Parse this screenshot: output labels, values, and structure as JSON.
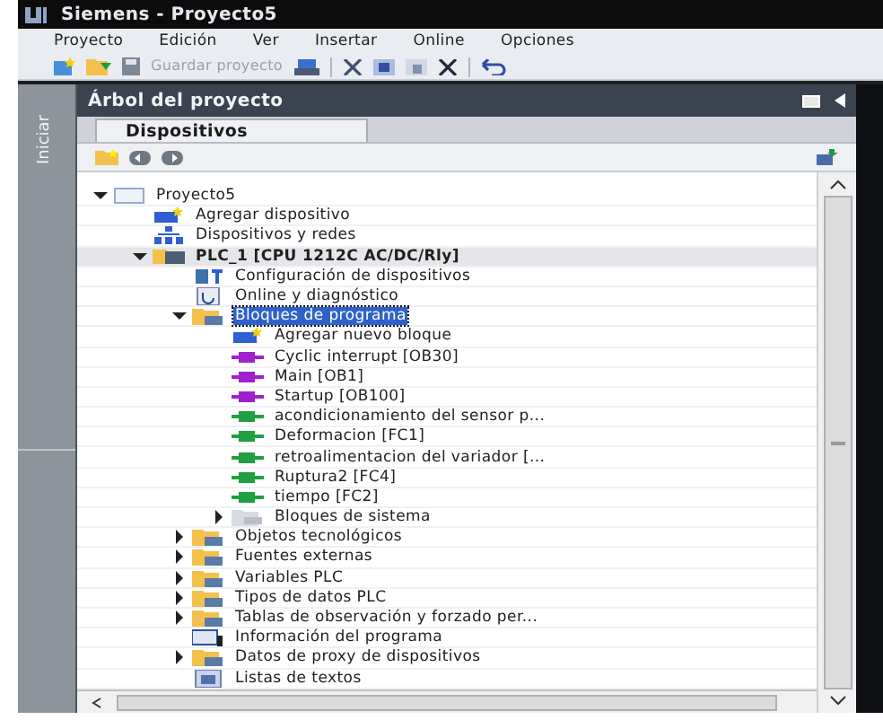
{
  "window": {
    "title": "Siemens  -  Proyecto5"
  },
  "menu": [
    "Proyecto",
    "Edición",
    "Ver",
    "Insertar",
    "Online",
    "Opciones"
  ],
  "toolbar": {
    "save_label": "Guardar proyecto"
  },
  "side_tab": "Iniciar",
  "panel": {
    "title": "Árbol del proyecto"
  },
  "tabs": [
    {
      "label": "Dispositivos",
      "selected": true
    }
  ],
  "tree": [
    {
      "label": "Proyecto5",
      "kind": "project",
      "expanded": true,
      "selected": false,
      "children": [
        {
          "label": "Agregar dispositivo",
          "kind": "add",
          "selected": false
        },
        {
          "label": "Dispositivos y redes",
          "kind": "network",
          "selected": false
        },
        {
          "label": "PLC_1 [CPU 1212C AC/DC/Rly]",
          "kind": "plc",
          "expanded": true,
          "selected": false,
          "children": [
            {
              "label": "Configuración de dispositivos",
              "kind": "config",
              "selected": false
            },
            {
              "label": "Online y diagnóstico",
              "kind": "diag",
              "selected": false
            },
            {
              "label": "Bloques de programa",
              "kind": "folder",
              "expanded": true,
              "selected": true,
              "children": [
                {
                  "label": "Agregar nuevo bloque",
                  "kind": "add",
                  "selected": false
                },
                {
                  "label": "Cyclic interrupt [OB30]",
                  "kind": "ob",
                  "selected": false
                },
                {
                  "label": "Main [OB1]",
                  "kind": "ob",
                  "selected": false
                },
                {
                  "label": "Startup [OB100]",
                  "kind": "ob",
                  "selected": false
                },
                {
                  "label": "acondicionamiento del sensor p...",
                  "kind": "fc",
                  "selected": false
                },
                {
                  "label": "Deformacion [FC1]",
                  "kind": "fc",
                  "selected": false
                },
                {
                  "label": "retroalimentacion del variador [...",
                  "kind": "fc",
                  "selected": false
                },
                {
                  "label": "Ruptura2 [FC4]",
                  "kind": "fc",
                  "selected": false
                },
                {
                  "label": "tiempo [FC2]",
                  "kind": "fc",
                  "selected": false
                },
                {
                  "label": "Bloques de sistema",
                  "kind": "sysfolder",
                  "expanded": false,
                  "selected": false
                }
              ]
            },
            {
              "label": "Objetos tecnológicos",
              "kind": "folder",
              "expanded": false,
              "selected": false
            },
            {
              "label": "Fuentes externas",
              "kind": "folder",
              "expanded": false,
              "selected": false
            },
            {
              "label": "Variables PLC",
              "kind": "folder",
              "expanded": false,
              "selected": false
            },
            {
              "label": "Tipos de datos PLC",
              "kind": "folder",
              "expanded": false,
              "selected": false
            },
            {
              "label": "Tablas de observación y forzado per...",
              "kind": "folder",
              "expanded": false,
              "selected": false
            },
            {
              "label": "Información del programa",
              "kind": "info",
              "selected": false
            },
            {
              "label": "Datos de proxy de dispositivos",
              "kind": "folder",
              "expanded": false,
              "selected": false
            },
            {
              "label": "Listas de textos",
              "kind": "texts",
              "selected": false
            }
          ]
        }
      ]
    }
  ]
}
